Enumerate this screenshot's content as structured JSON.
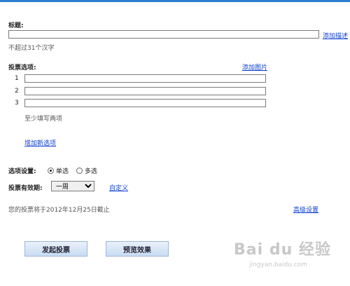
{
  "title_section": {
    "label": "标题:",
    "value": "",
    "add_desc_link": "添加描述",
    "hint": "不超过31个汉字"
  },
  "options_section": {
    "label": "投票选项:",
    "add_image_link": "添加图片",
    "options": [
      {
        "num": "1",
        "value": ""
      },
      {
        "num": "2",
        "value": ""
      },
      {
        "num": "3",
        "value": ""
      }
    ],
    "hint": "至少填写两项",
    "add_option_link": "增加新选项"
  },
  "settings": {
    "label": "选项设置:",
    "single": "单选",
    "multi": "多选",
    "selected": "single"
  },
  "validity": {
    "label": "投票有效期:",
    "selected": "一周",
    "custom_link": "自定义"
  },
  "deadline_text": "您的投票将于2012年12月25日截止",
  "advanced_link": "高级设置",
  "buttons": {
    "submit": "发起投票",
    "preview": "预览效果"
  },
  "watermark": {
    "brand": "Bai du 经验",
    "url": "jingyan.baidu.com"
  },
  "colors": {
    "accent": "#2f7fd0",
    "link": "#0d3fcf"
  }
}
